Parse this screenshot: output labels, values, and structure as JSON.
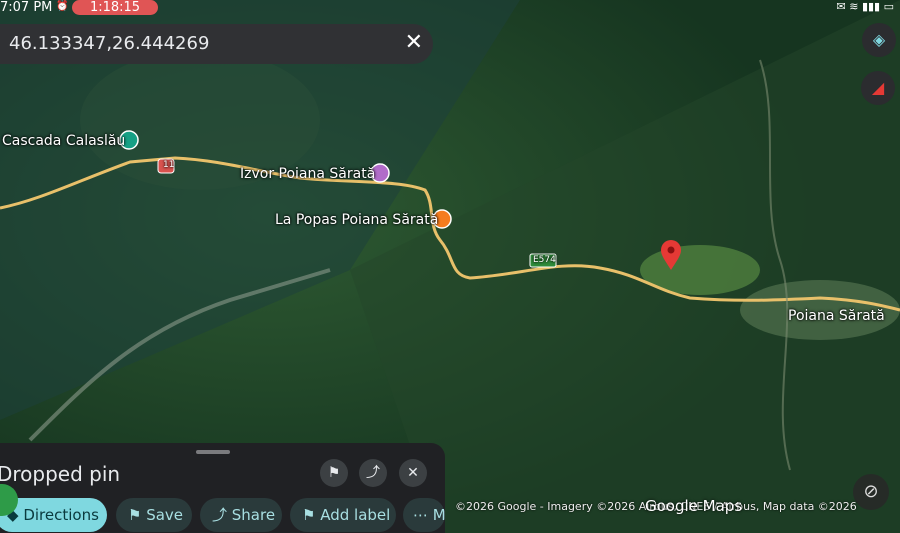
{
  "status_bar": {
    "time": "7:07 PM",
    "pill_text": "1:18:15",
    "alarm_icon": "alarm-icon",
    "right_icons": "wifi-icon signal-icon battery-icon"
  },
  "search": {
    "query": "46.133347,26.444269",
    "close_icon": "close-icon"
  },
  "map": {
    "labels": {
      "waterfall": "Cascada Calaslău",
      "spring": "Izvor Poiana Sărată",
      "restaurant": "La Popas Poiana Sărată",
      "village": "Poiana Sărată",
      "road_shield": "E574",
      "route_shield": "11"
    },
    "colors": {
      "forest_dark": "#1b3d22",
      "forest_light": "#2f5a2e",
      "road": "#e8c06a",
      "pin": "#e53935",
      "poi_waterfall": "#16a085",
      "poi_spring": "#b16cc9",
      "poi_restaurant": "#f57c1f"
    }
  },
  "buttons": {
    "layers_icon": "layers-icon",
    "compass_icon": "compass-icon",
    "location_icon": "my-location-icon"
  },
  "sheet": {
    "title": "Dropped pin",
    "bookmark_icon": "bookmark-icon",
    "share_icon": "share-icon",
    "close_icon": "close-icon",
    "chips": {
      "directions": "Directions",
      "save": "Save",
      "share": "Share",
      "add_label": "Add label",
      "more": "M"
    }
  },
  "attribution": {
    "text": "©2026 Google - Imagery ©2026 Airbus, CNES / Airbus, Map data ©2026",
    "logo": "Google Maps"
  }
}
